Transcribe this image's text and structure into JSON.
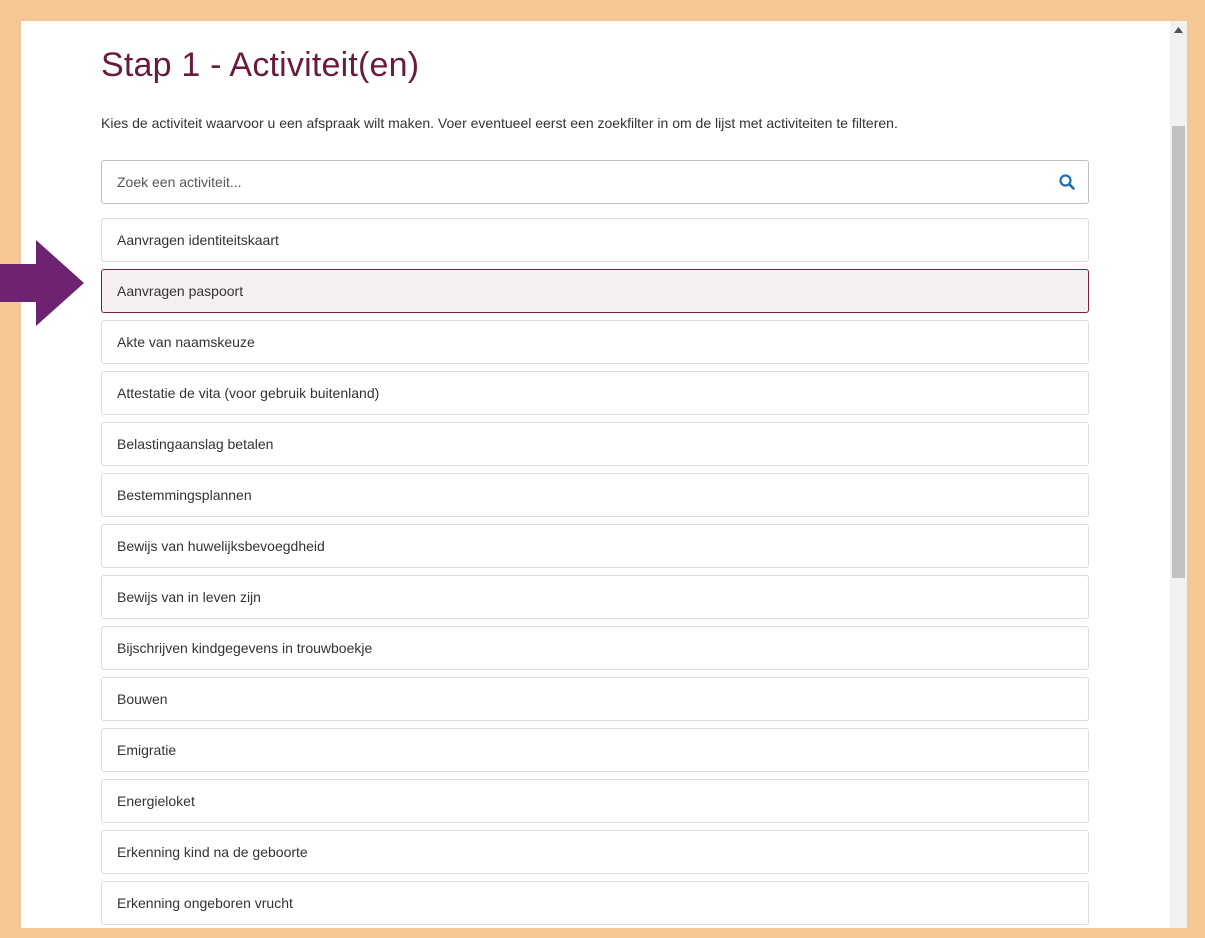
{
  "page": {
    "title": "Stap 1 - Activiteit(en)",
    "intro": "Kies de activiteit waarvoor u een afspraak wilt maken. Voer eventueel eerst een zoekfilter in om de lijst met activiteiten te filteren."
  },
  "search": {
    "placeholder": "Zoek een activiteit...",
    "value": "",
    "icon": "search-icon"
  },
  "activities": [
    {
      "label": "Aanvragen identiteitskaart",
      "selected": false
    },
    {
      "label": "Aanvragen paspoort",
      "selected": true
    },
    {
      "label": "Akte van naamskeuze",
      "selected": false
    },
    {
      "label": "Attestatie de vita (voor gebruik buitenland)",
      "selected": false
    },
    {
      "label": "Belastingaanslag betalen",
      "selected": false
    },
    {
      "label": "Bestemmingsplannen",
      "selected": false
    },
    {
      "label": "Bewijs van huwelijksbevoegdheid",
      "selected": false
    },
    {
      "label": "Bewijs van in leven zijn",
      "selected": false
    },
    {
      "label": "Bijschrijven kindgegevens in trouwboekje",
      "selected": false
    },
    {
      "label": "Bouwen",
      "selected": false
    },
    {
      "label": "Emigratie",
      "selected": false
    },
    {
      "label": "Energieloket",
      "selected": false
    },
    {
      "label": "Erkenning kind na de geboorte",
      "selected": false
    },
    {
      "label": "Erkenning ongeboren vrucht",
      "selected": false
    }
  ],
  "colors": {
    "accent": "#6b1a3f",
    "arrow": "#6e2370",
    "frame": "#f5c893",
    "selected_bg": "#f5eff2",
    "search_icon": "#1a6fb5"
  }
}
